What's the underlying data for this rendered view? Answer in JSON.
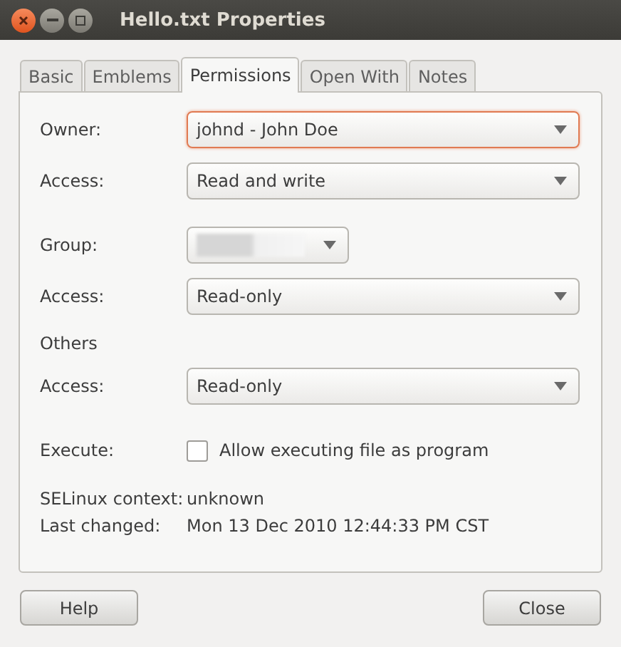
{
  "window": {
    "title": "Hello.txt Properties"
  },
  "tabs": [
    {
      "label": "Basic",
      "selected": false
    },
    {
      "label": "Emblems",
      "selected": false
    },
    {
      "label": "Permissions",
      "selected": true
    },
    {
      "label": "Open With",
      "selected": false
    },
    {
      "label": "Notes",
      "selected": false
    }
  ],
  "sections": [
    {
      "rows": [
        {
          "kind": "dropdown",
          "label": "Owner:",
          "value": "johnd - John Doe",
          "focused": true
        },
        {
          "kind": "dropdown",
          "label": "Access:",
          "value": "Read and write",
          "focused": false
        }
      ]
    },
    {
      "rows": [
        {
          "kind": "blurred",
          "label": "Group:",
          "focused": false
        },
        {
          "kind": "dropdown",
          "label": "Access:",
          "value": "Read-only",
          "focused": false
        }
      ]
    },
    {
      "rows": [
        {
          "kind": "heading",
          "label": "Others"
        },
        {
          "kind": "dropdown",
          "label": "Access:",
          "value": "Read-only",
          "focused": false
        }
      ]
    },
    {
      "rows": [
        {
          "kind": "checkbox",
          "label": "Execute:",
          "value": "Allow executing file as program",
          "checked": false
        }
      ]
    },
    {
      "rows": [
        {
          "kind": "info",
          "label": "SELinux context:",
          "value": "unknown"
        },
        {
          "kind": "info",
          "label": "Last changed:",
          "value": "Mon 13 Dec 2010 12:44:33 PM CST"
        }
      ]
    }
  ],
  "buttons": [
    "Help",
    "Close"
  ]
}
